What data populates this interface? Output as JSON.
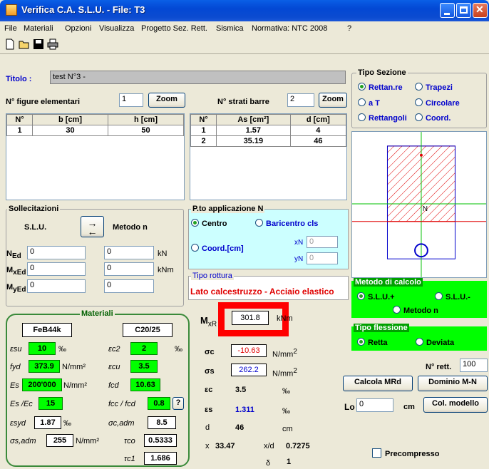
{
  "window": {
    "title": "Verifica C.A. S.L.U. - File: T3"
  },
  "menu": [
    "File",
    "Materiali",
    "Opzioni",
    "Visualizza",
    "Progetto Sez. Rett.",
    "Sismica",
    "Normativa: NTC 2008",
    "?"
  ],
  "titolo": {
    "label": "Titolo :",
    "value": "test N°3 -"
  },
  "figure": {
    "label": "N° figure elementari",
    "value": "1",
    "zoom": "Zoom"
  },
  "strati": {
    "label": "N° strati barre",
    "value": "2",
    "zoom": "Zoom"
  },
  "figure_table": {
    "headers": [
      "N°",
      "b [cm]",
      "h [cm]"
    ],
    "rows": [
      [
        "1",
        "30",
        "50"
      ]
    ]
  },
  "bars_table": {
    "headers": [
      "N°",
      "As [cm²]",
      "d [cm]"
    ],
    "rows": [
      [
        "1",
        "1.57",
        "4"
      ],
      [
        "2",
        "35.19",
        "46"
      ]
    ]
  },
  "tipo_sezione": {
    "title": "Tipo Sezione",
    "options": [
      "Rettan.re",
      "Trapezi",
      "a T",
      "Circolare",
      "Rettangoli",
      "Coord."
    ],
    "selected": "Rettan.re"
  },
  "sollecitazioni": {
    "title": "Sollecitazioni",
    "slu": "S.L.U.",
    "metodo": "Metodo n",
    "NEd": "0",
    "MxEd": "0",
    "MyEd": "0",
    "n1": "0",
    "n2": "0",
    "n3": "0",
    "unit_kN": "kN",
    "unit_kNm": "kNm",
    "lbl_N": "N",
    "sub_N": "Ed",
    "lbl_Mx": "M",
    "sub_Mx": "xEd",
    "lbl_My": "M",
    "sub_My": "yEd"
  },
  "punto_applicazione": {
    "title": "P.to applicazione N",
    "centro": "Centro",
    "baricentro": "Baricentro cls",
    "coord": "Coord.[cm]",
    "xN_label": "xN",
    "yN_label": "yN",
    "xN": "0",
    "yN": "0"
  },
  "tipo_rottura": {
    "title": "Tipo rottura",
    "value": "Lato calcestruzzo - Acciaio elastico"
  },
  "metodo_calcolo": {
    "title": "Metodo di calcolo",
    "options": [
      "S.L.U.+",
      "S.L.U.-",
      "Metodo n"
    ],
    "selected": "S.L.U.+"
  },
  "tipo_flessione": {
    "title": "Tipo flessione",
    "options": [
      "Retta",
      "Deviata"
    ],
    "selected": "Retta"
  },
  "materiali": {
    "title": "Materiali",
    "steel": "FeB44k",
    "concrete": "C20/25",
    "esu": "10",
    "ec2": "2",
    "fyd": "373.9",
    "ecu": "3.5",
    "Es": "200'000",
    "fcd": "10.63",
    "EsEc": "15",
    "fcc_fcd": "0.8",
    "esyd": "1.87",
    "sc_adm": "8.5",
    "ss_adm": "255",
    "tco": "0.5333",
    "tc1": "1.686",
    "permille": "‰",
    "nmm2": "N/mm²",
    "q": "?",
    "lbl_esu": "εsu",
    "lbl_ec2": "εc2",
    "lbl_fyd": "fyd",
    "lbl_ecu": "εcu",
    "lbl_Es": "Es",
    "lbl_fcd": "fcd",
    "lbl_EsEc": "Es /Ec",
    "lbl_fccfcd": "fcc / fcd",
    "lbl_esyd": "εsyd",
    "lbl_scadm": "σc,adm",
    "lbl_ssadm": "σs,adm",
    "lbl_tco": "τco",
    "lbl_tc1": "τc1"
  },
  "risultati": {
    "MxR_label": "M",
    "MxR_sub": "xR",
    "MxR": "301.8",
    "MxR_unit": "kNm",
    "sc_lbl": "σc",
    "sc": "-10.63",
    "ss_lbl": "σs",
    "ss": "262.2",
    "ec_lbl": "εc",
    "ec": "3.5",
    "es_lbl": "εs",
    "es": "1.311",
    "d_lbl": "d",
    "d": "46",
    "d_unit": "cm",
    "x_lbl": "x",
    "x": "33.47",
    "xd_lbl": "x/d",
    "xd": "0.7275",
    "delta_lbl": "δ",
    "delta": "1",
    "unit_nmm2": "N/mm",
    "unit_sup": "2",
    "permille": "‰"
  },
  "right_controls": {
    "n_rett_label": "N° rett.",
    "n_rett": "100",
    "calcola": "Calcola MRd",
    "dominio": "Dominio M-N",
    "lo_label": "Lo",
    "lo": "0",
    "lo_unit": "cm",
    "col_modello": "Col. modello",
    "precompresso": "Precompresso"
  },
  "section_drawing": {
    "neutral_axis_label": "N"
  },
  "colors": {
    "highlight": "#FF0000",
    "green_panel": "#00FF00",
    "light_blue": "#CCFFFF"
  }
}
